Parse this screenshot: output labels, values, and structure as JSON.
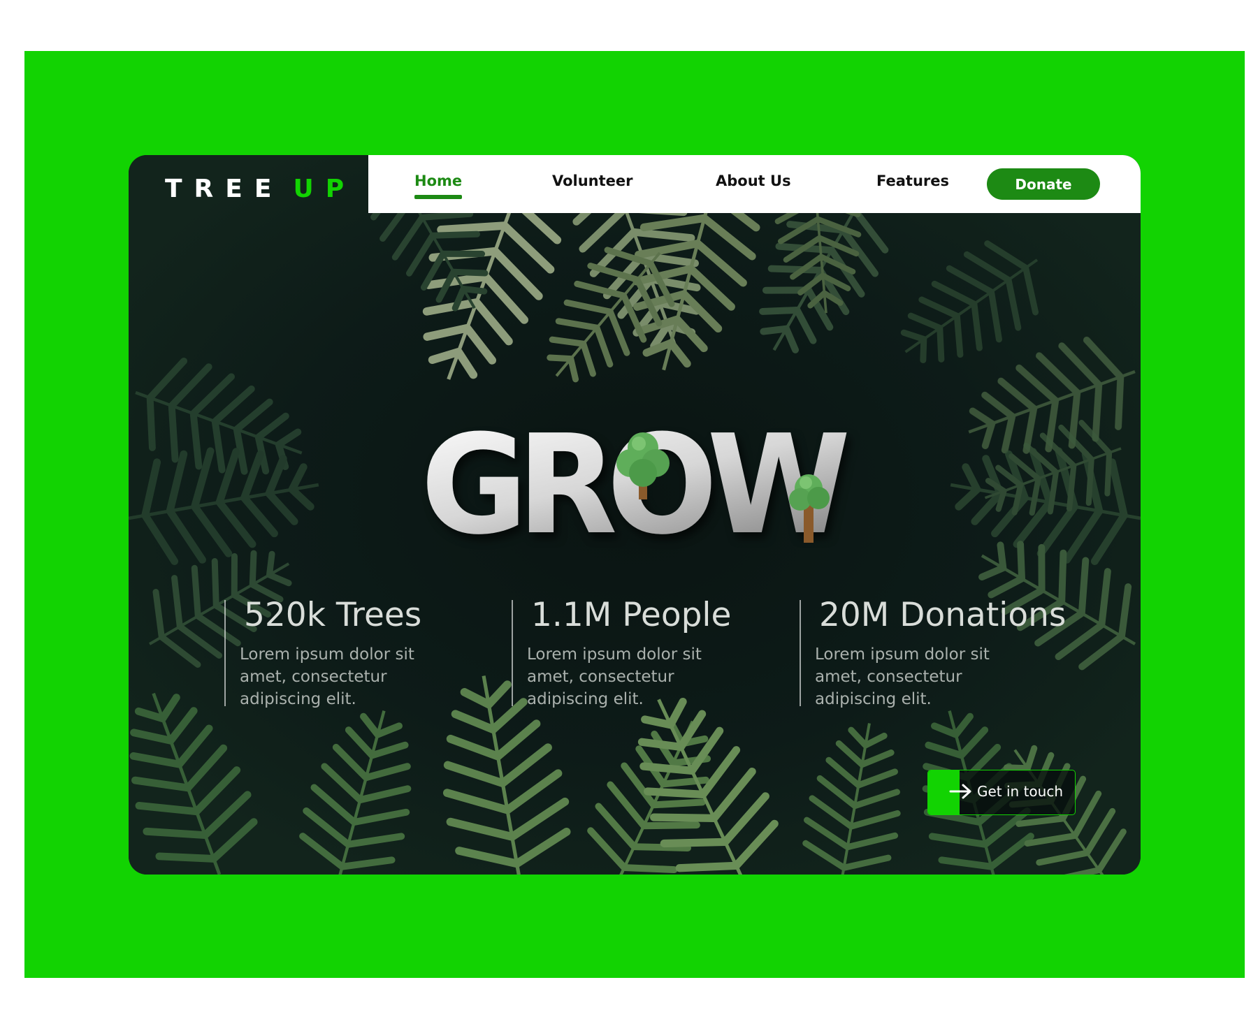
{
  "brand": {
    "name_main": "TREE",
    "name_accent": "UP"
  },
  "nav": {
    "items": [
      {
        "label": "Home",
        "active": true
      },
      {
        "label": "Volunteer",
        "active": false
      },
      {
        "label": "About Us",
        "active": false
      },
      {
        "label": "Features",
        "active": false
      }
    ],
    "donate_label": "Donate"
  },
  "hero": {
    "word": "GROW"
  },
  "stats": [
    {
      "value": "520k Trees",
      "description": "Lorem ipsum dolor sit amet, consectetur adipiscing elit."
    },
    {
      "value": "1.1M People",
      "description": "Lorem ipsum dolor sit amet, consectetur adipiscing elit."
    },
    {
      "value": "20M Donations",
      "description": "Lorem ipsum dolor sit amet, consectetur adipiscing elit."
    }
  ],
  "cta": {
    "label": "Get in touch",
    "icon": "arrow-right-icon"
  },
  "colors": {
    "backdrop_green": "#12d302",
    "accent_dark_green": "#1d8a14",
    "card_background": "#0c1816",
    "text_light": "#d9ddd9"
  }
}
